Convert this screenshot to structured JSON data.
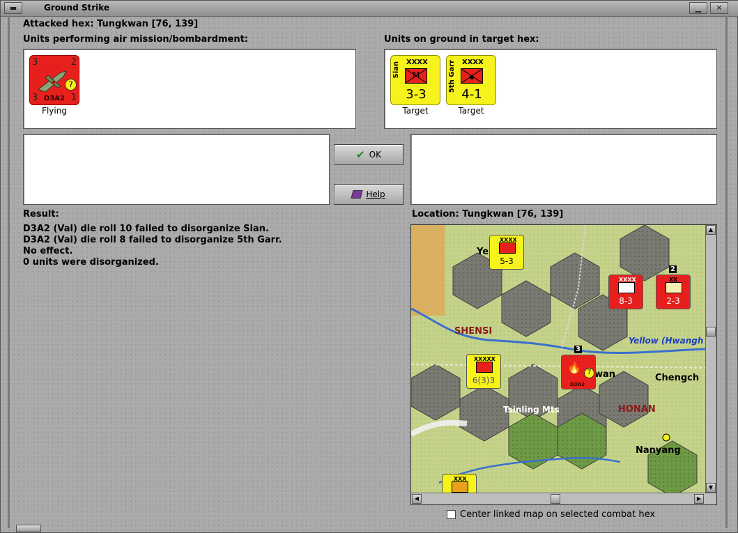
{
  "window": {
    "title": "Ground Strike"
  },
  "header": {
    "attacked_hex": "Attacked hex: Tungkwan  [76, 139]",
    "air_units_label": "Units performing air mission/bombardment:",
    "ground_units_label": "Units on ground in target hex:"
  },
  "air_units": [
    {
      "name": "D3A2",
      "tl": "3",
      "tr": "2",
      "bl": "3",
      "br": "1",
      "badge": "7",
      "status": "Flying"
    }
  ],
  "ground_units": [
    {
      "name": "Sian",
      "size": "XXXX",
      "type_letter": "M",
      "strength": "3-3",
      "status": "Target"
    },
    {
      "name": "5th Garr",
      "size": "XXXX",
      "type_letter": "",
      "strength": "4-1",
      "status": "Target"
    }
  ],
  "buttons": {
    "ok": "OK",
    "help": "Help"
  },
  "result": {
    "label": "Result:",
    "lines": [
      "D3A2 (Val) die roll 10 failed to disorganize Sian.",
      "D3A2 (Val) die roll 8 failed to disorganize 5th Garr.",
      "No effect.",
      "0 units were disorganized."
    ]
  },
  "location": {
    "label": "Location:  Tungkwan  [76, 139]"
  },
  "map": {
    "labels": {
      "shensi": "SHENSI",
      "honan": "HONAN",
      "tsinling": "Tsinling Mts",
      "yellow_river": "Yellow (Hwangh",
      "chengchow": "Chengch",
      "nanyang": "Nanyang",
      "tungkwan_partial": "wan",
      "yenan_partial": "Ye"
    },
    "counters": [
      {
        "id": "yellow-inf-top",
        "size": "XXXX",
        "strength": "5-3"
      },
      {
        "id": "red-inf-1",
        "size": "XXXX",
        "strength": "8-3"
      },
      {
        "id": "red-inf-2",
        "size": "XX",
        "strength": "2-3",
        "stack": "2"
      },
      {
        "id": "yellow-hq",
        "size": "XXXXX",
        "strength": "6(3)3"
      },
      {
        "id": "d3a2-map",
        "name": "D3A2",
        "badge": "7",
        "stack": "3"
      },
      {
        "id": "yellow-bottom",
        "size": "XXX",
        "strength": ""
      }
    ]
  },
  "footer": {
    "center_map_label": "Center linked map on selected combat hex",
    "center_map_checked": false
  },
  "colors": {
    "counter_red": "#e8201d",
    "counter_yellow": "#f6f21c"
  }
}
